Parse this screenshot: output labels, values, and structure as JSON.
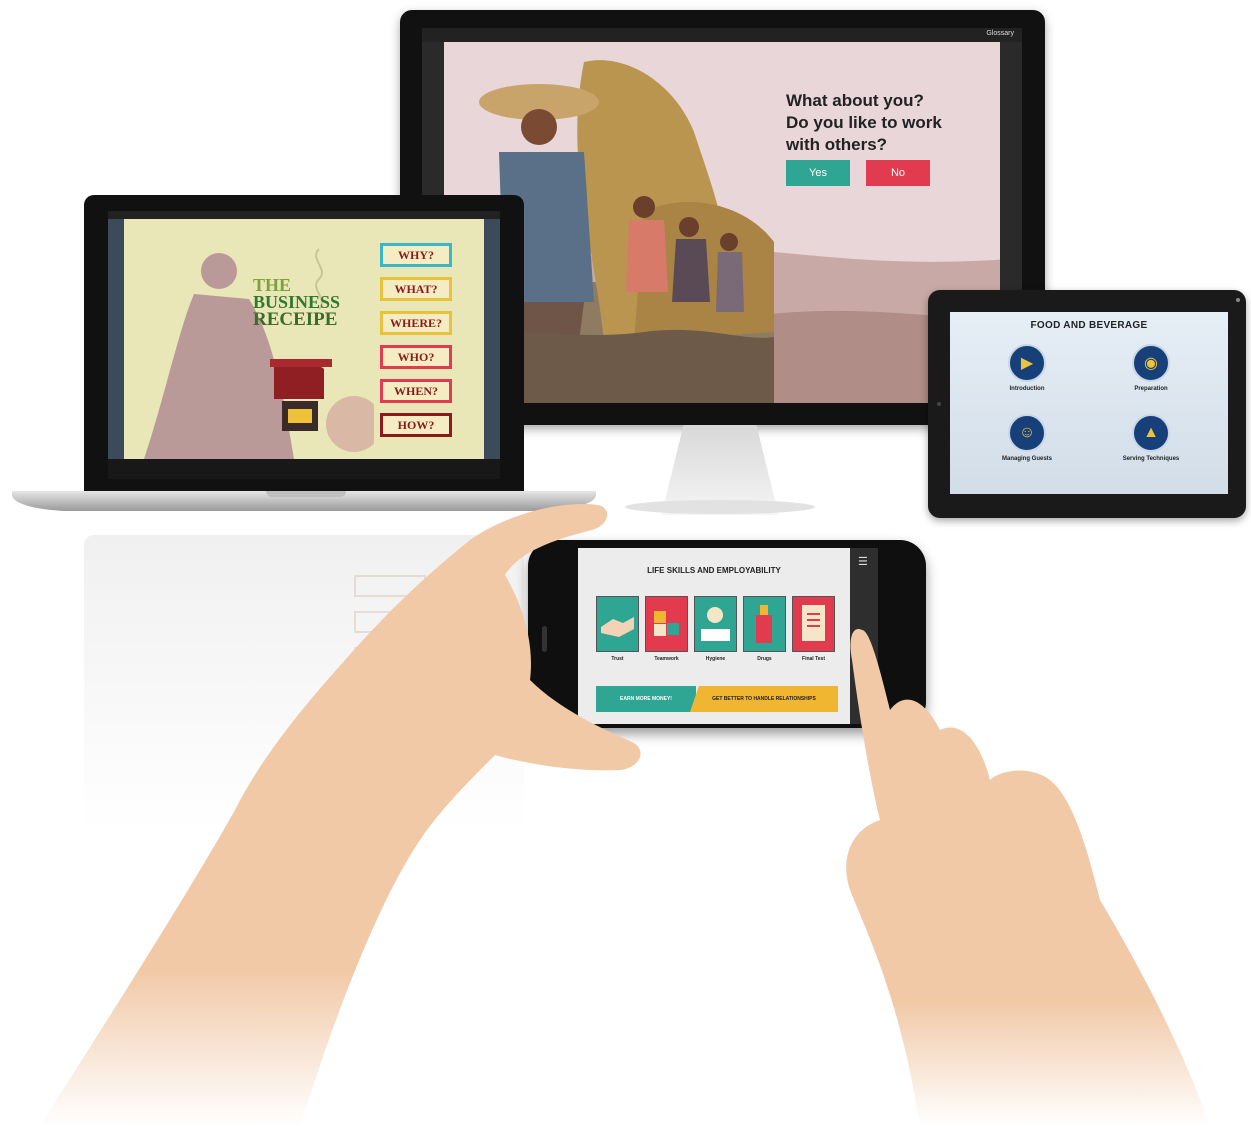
{
  "monitor": {
    "glossary_label": "Glossary",
    "question_lines": [
      "What about you?",
      "Do you like to work",
      "with others?"
    ],
    "yes_label": "Yes",
    "no_label": "No",
    "colors": {
      "yes": "#2fa593",
      "no": "#e23b4f",
      "background": "#e8d6d8"
    }
  },
  "laptop": {
    "title_lines": [
      "THE",
      "BUSINESS",
      "RECEIPE"
    ],
    "menu": [
      "WHY?",
      "WHAT?",
      "WHERE?",
      "WHO?",
      "WHEN?",
      "HOW?"
    ],
    "menu_border_colors": [
      "#3bb6c6",
      "#e8c23a",
      "#e8c23a",
      "#e23b4f",
      "#e23b4f",
      "#8c1a1a"
    ]
  },
  "tablet": {
    "title": "Food and Beverage",
    "items": [
      "Introduction",
      "Preparation",
      "Managing Guests",
      "Serving Techniques"
    ],
    "icons": [
      "megaphone-icon",
      "plate-icon",
      "guest-icon",
      "cloche-icon"
    ]
  },
  "phone": {
    "title": "LIFE SKILLS AND EMPLOYABILITY",
    "cards": [
      "Trust",
      "Teamwork",
      "Hygiene",
      "Drugs",
      "Final Test"
    ],
    "card_colors": [
      "#2fa593",
      "#e23b4f",
      "#2fa593",
      "#2fa593",
      "#e23b4f"
    ],
    "button_left": "EARN MORE MONEY!",
    "button_right": "GET BETTER TO HANDLE RELATIONSHIPS"
  }
}
